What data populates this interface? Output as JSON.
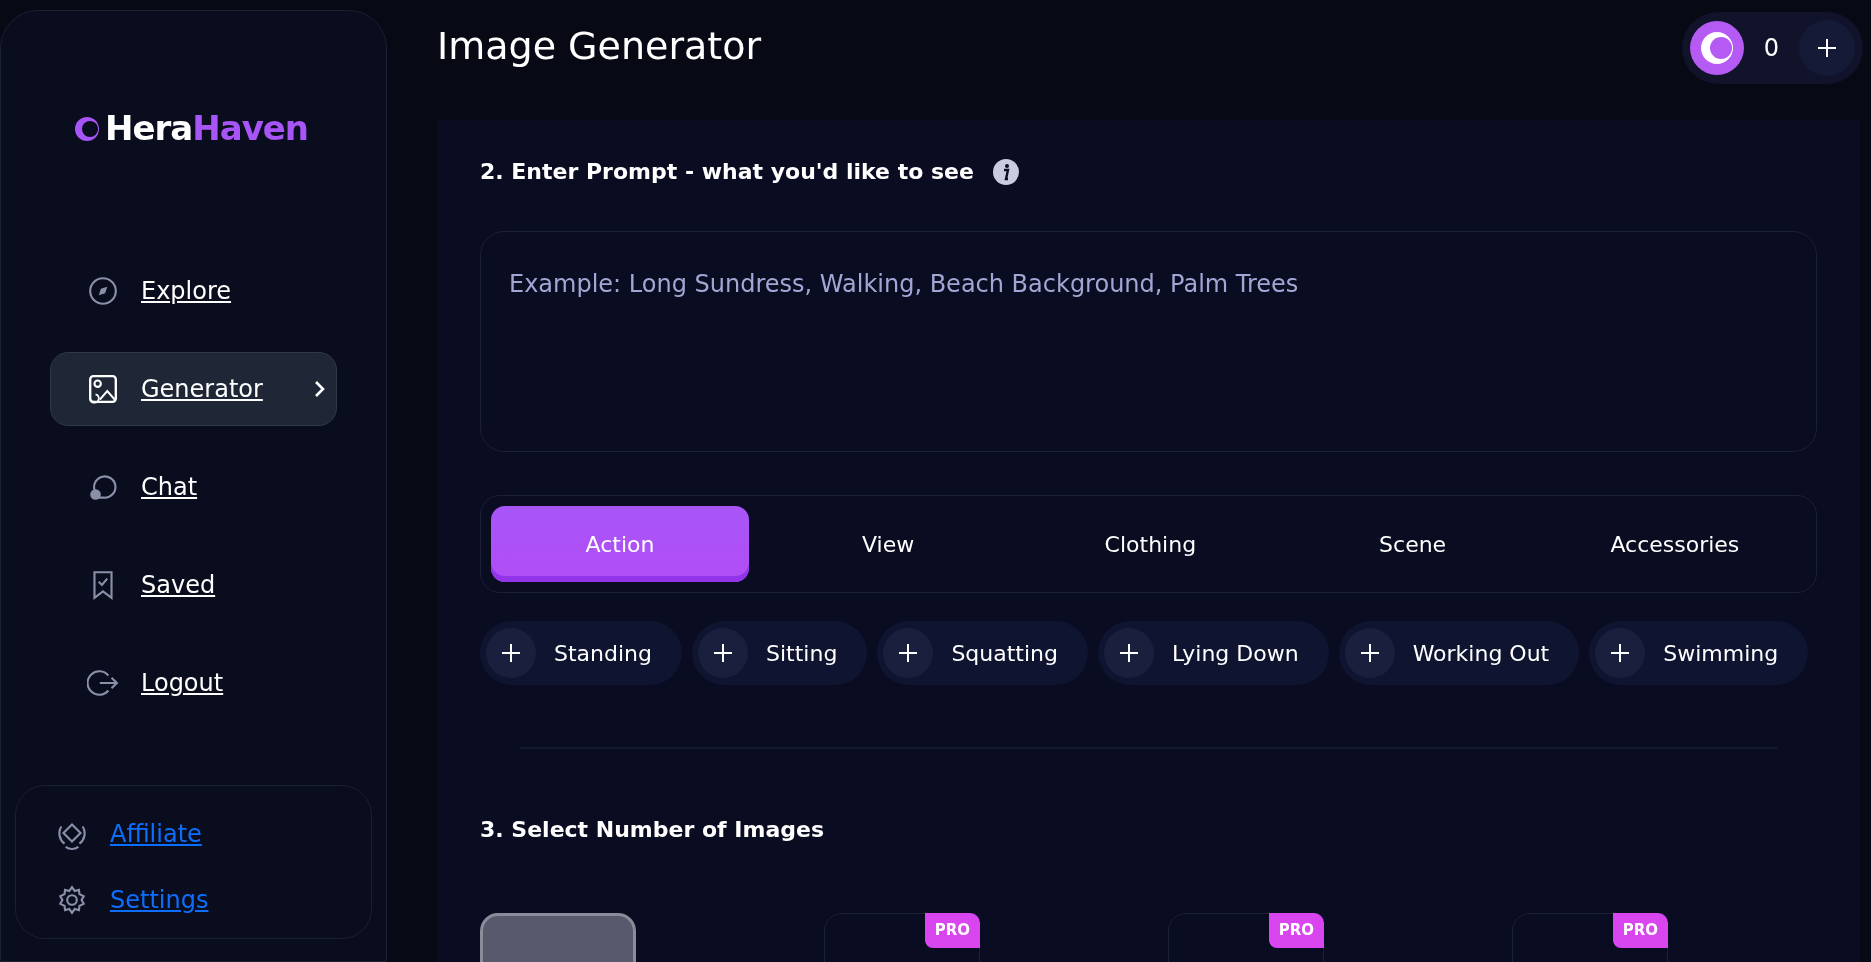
{
  "sidebar": {
    "logo": {
      "first": "Hera",
      "second": "Haven"
    },
    "items": [
      {
        "kind": "explore",
        "label": "Explore",
        "selected": false
      },
      {
        "kind": "generator",
        "label": "Generator",
        "selected": true
      },
      {
        "kind": "chat",
        "label": "Chat",
        "selected": false
      },
      {
        "kind": "saved",
        "label": "Saved",
        "selected": false
      },
      {
        "kind": "logout",
        "label": "Logout",
        "selected": false
      }
    ],
    "footer_items": [
      {
        "kind": "affiliate",
        "label": "Affiliate"
      },
      {
        "kind": "settings",
        "label": "Settings"
      }
    ]
  },
  "header": {
    "title": "Image Generator",
    "credits": "0"
  },
  "prompt_section": {
    "heading": "2. Enter Prompt - what you'd like to see",
    "placeholder": "Example: Long Sundress, Walking, Beach Background, Palm Trees",
    "tabs": [
      {
        "label": "Action",
        "selected": true
      },
      {
        "label": "View",
        "selected": false
      },
      {
        "label": "Clothing",
        "selected": false
      },
      {
        "label": "Scene",
        "selected": false
      },
      {
        "label": "Accessories",
        "selected": false
      }
    ],
    "chips": [
      "Standing",
      "Sitting",
      "Squatting",
      "Lying Down",
      "Working Out",
      "Swimming"
    ]
  },
  "images_section": {
    "heading": "3. Select Number of Images",
    "options": [
      {
        "selected": true
      },
      {
        "selected": false,
        "badge": "PRO"
      },
      {
        "selected": false,
        "badge": "PRO"
      },
      {
        "selected": false,
        "badge": "PRO"
      }
    ]
  }
}
